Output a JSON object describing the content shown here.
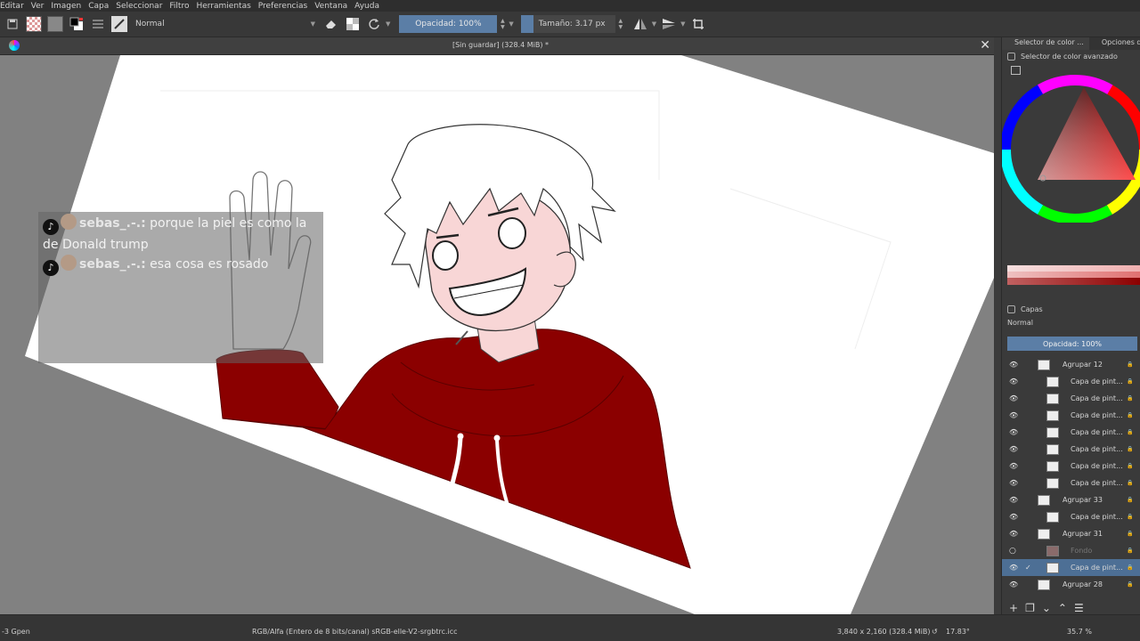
{
  "menu": [
    "Editar",
    "Ver",
    "Imagen",
    "Capa",
    "Seleccionar",
    "Filtro",
    "Herramientas",
    "Preferencias",
    "Ventana",
    "Ayuda"
  ],
  "toolbar": {
    "blend_mode": "Normal",
    "opacity_label": "Opacidad: 100%",
    "size_label": "Tamaño: 3.17 px"
  },
  "document": {
    "title": "[Sin guardar]  (328.4 MiB) *"
  },
  "chat": [
    {
      "user": "sebas_.-.:",
      "message": "porque la piel es como la de Donald trump",
      "icon": "tiktok-icon"
    },
    {
      "user": "sebas_.-.:",
      "message": "esa cosa es rosado",
      "icon": "tiktok-icon"
    }
  ],
  "dock": {
    "tabs": [
      "Selector de color ...",
      "Opciones de h"
    ],
    "color_panel_title": "Selector de color avanzado",
    "layers_title": "Capas",
    "layers_mode": "Normal",
    "layers_opacity": "Opacidad:  100%",
    "layers": [
      {
        "name": "Agrupar 12",
        "indent": 0,
        "visible": true,
        "group": true
      },
      {
        "name": "Capa de pint...",
        "indent": 1,
        "visible": true,
        "group": false
      },
      {
        "name": "Capa de pint...",
        "indent": 1,
        "visible": true,
        "group": false
      },
      {
        "name": "Capa de pint...",
        "indent": 1,
        "visible": true,
        "group": false
      },
      {
        "name": "Capa de pint...",
        "indent": 1,
        "visible": true,
        "group": false
      },
      {
        "name": "Capa de pint...",
        "indent": 1,
        "visible": true,
        "group": false
      },
      {
        "name": "Capa de pint...",
        "indent": 1,
        "visible": true,
        "group": false
      },
      {
        "name": "Capa de pint...",
        "indent": 1,
        "visible": true,
        "group": false
      },
      {
        "name": "Agrupar 33",
        "indent": 0,
        "visible": true,
        "group": true
      },
      {
        "name": "Capa de pint...",
        "indent": 1,
        "visible": true,
        "group": false
      },
      {
        "name": "Agrupar 31",
        "indent": 0,
        "visible": true,
        "group": true
      },
      {
        "name": "Fondo",
        "indent": 1,
        "visible": false,
        "group": false
      },
      {
        "name": "Capa de pint...",
        "indent": 1,
        "visible": true,
        "group": false,
        "selected": true
      },
      {
        "name": "Agrupar 28",
        "indent": 0,
        "visible": true,
        "group": true
      }
    ]
  },
  "status": {
    "brush": "-3 Gpen",
    "colorspace": "RGB/Alfa (Entero de 8 bits/canal)  sRGB-elle-V2-srgbtrc.icc",
    "dimensions": "3,840 x 2,160 (328.4 MiB)",
    "rotation": "17.83°",
    "zoom": "35.7 %"
  },
  "colors": {
    "accent": "#5b7ea6",
    "hoodie": "#8b0000",
    "skin": "#f8d6d6"
  }
}
